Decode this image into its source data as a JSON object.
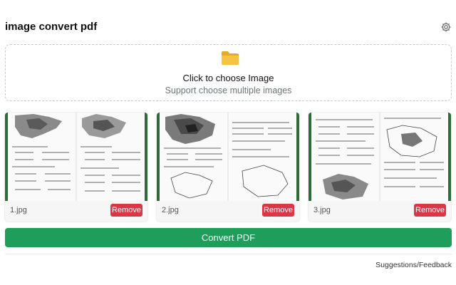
{
  "app": {
    "title": "image convert pdf",
    "settings_icon": "gear-icon"
  },
  "dropzone": {
    "icon": "folder-icon",
    "title": "Click to choose Image",
    "subtitle": "Support choose multiple images"
  },
  "images": [
    {
      "filename": "1.jpg",
      "remove_label": "Remove",
      "thumbnail": "scanned worksheet page with maps and fill-in blanks"
    },
    {
      "filename": "2.jpg",
      "remove_label": "Remove",
      "thumbnail": "scanned worksheet page with maps and fill-in blanks"
    },
    {
      "filename": "3.jpg",
      "remove_label": "Remove",
      "thumbnail": "scanned worksheet page with maps and fill-in blanks"
    }
  ],
  "actions": {
    "convert_label": "Convert PDF"
  },
  "footer": {
    "feedback_label": "Suggestions/Feedback"
  },
  "colors": {
    "accent": "#1e9e5a",
    "danger": "#dc3545",
    "thumbnail_border": "#2f6b3a",
    "folder": "#f6c343",
    "muted_text": "#6c757d"
  }
}
